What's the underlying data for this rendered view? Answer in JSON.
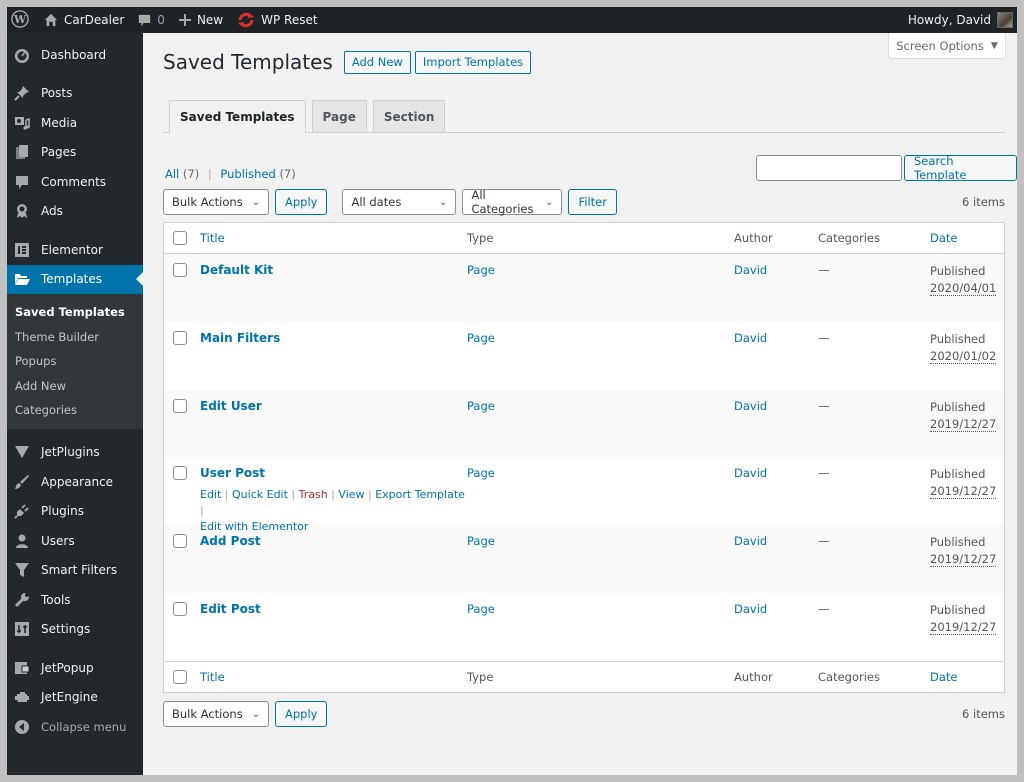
{
  "adminbar": {
    "site_name": "CarDealer",
    "comments_count": "0",
    "new_label": "New",
    "wp_reset_label": "WP Reset",
    "howdy": "Howdy, David"
  },
  "sidebar": {
    "items": [
      {
        "label": "Dashboard",
        "icon": "dashboard-icon"
      },
      {
        "label": "Posts",
        "icon": "pin-icon"
      },
      {
        "label": "Media",
        "icon": "media-icon"
      },
      {
        "label": "Pages",
        "icon": "pages-icon"
      },
      {
        "label": "Comments",
        "icon": "comment-icon"
      },
      {
        "label": "Ads",
        "icon": "award-icon"
      },
      {
        "label": "Elementor",
        "icon": "elementor-icon"
      },
      {
        "label": "Templates",
        "icon": "folder-icon"
      },
      {
        "label": "JetPlugins",
        "icon": "jet-icon"
      },
      {
        "label": "Appearance",
        "icon": "brush-icon"
      },
      {
        "label": "Plugins",
        "icon": "plug-icon"
      },
      {
        "label": "Users",
        "icon": "user-icon"
      },
      {
        "label": "Smart Filters",
        "icon": "filter-icon"
      },
      {
        "label": "Tools",
        "icon": "wrench-icon"
      },
      {
        "label": "Settings",
        "icon": "settings-icon"
      },
      {
        "label": "JetPopup",
        "icon": "popup-icon"
      },
      {
        "label": "JetEngine",
        "icon": "engine-icon"
      }
    ],
    "submenu": [
      "Saved Templates",
      "Theme Builder",
      "Popups",
      "Add New",
      "Categories"
    ],
    "collapse_label": "Collapse menu"
  },
  "screen_options": "Screen Options",
  "page": {
    "title": "Saved Templates",
    "add_new": "Add New",
    "import": "Import Templates"
  },
  "tabs": [
    "Saved Templates",
    "Page",
    "Section"
  ],
  "views": {
    "all_label": "All",
    "all_count": "(7)",
    "published_label": "Published",
    "published_count": "(7)"
  },
  "search": {
    "value": "",
    "button": "Search Template"
  },
  "filters": {
    "bulk_actions": "Bulk Actions",
    "apply": "Apply",
    "dates": "All dates",
    "categories": "All Categories",
    "filter": "Filter",
    "items_count": "6 items"
  },
  "table": {
    "columns": [
      "Title",
      "Type",
      "Author",
      "Categories",
      "Date"
    ],
    "rows": [
      {
        "title": "Default Kit",
        "type": "Page",
        "author": "David",
        "categories": "—",
        "status": "Published",
        "date": "2020/04/01"
      },
      {
        "title": "Main Filters",
        "type": "Page",
        "author": "David",
        "categories": "—",
        "status": "Published",
        "date": "2020/01/02"
      },
      {
        "title": "Edit User",
        "type": "Page",
        "author": "David",
        "categories": "—",
        "status": "Published",
        "date": "2019/12/27"
      },
      {
        "title": "User Post",
        "type": "Page",
        "author": "David",
        "categories": "—",
        "status": "Published",
        "date": "2019/12/27"
      },
      {
        "title": "Add Post",
        "type": "Page",
        "author": "David",
        "categories": "—",
        "status": "Published",
        "date": "2019/12/27"
      },
      {
        "title": "Edit Post",
        "type": "Page",
        "author": "David",
        "categories": "—",
        "status": "Published",
        "date": "2019/12/27"
      }
    ],
    "row_actions": {
      "edit": "Edit",
      "quick_edit": "Quick Edit",
      "trash": "Trash",
      "view": "View",
      "export": "Export Template",
      "edit_elementor": "Edit with Elementor"
    }
  },
  "bottom": {
    "bulk_actions": "Bulk Actions",
    "apply": "Apply",
    "items_count": "6 items"
  },
  "colors": {
    "accent": "#0073aa",
    "adminbar_bg": "#1d2327",
    "sidebar_bg": "#23282d",
    "trash": "#b32d2e"
  }
}
